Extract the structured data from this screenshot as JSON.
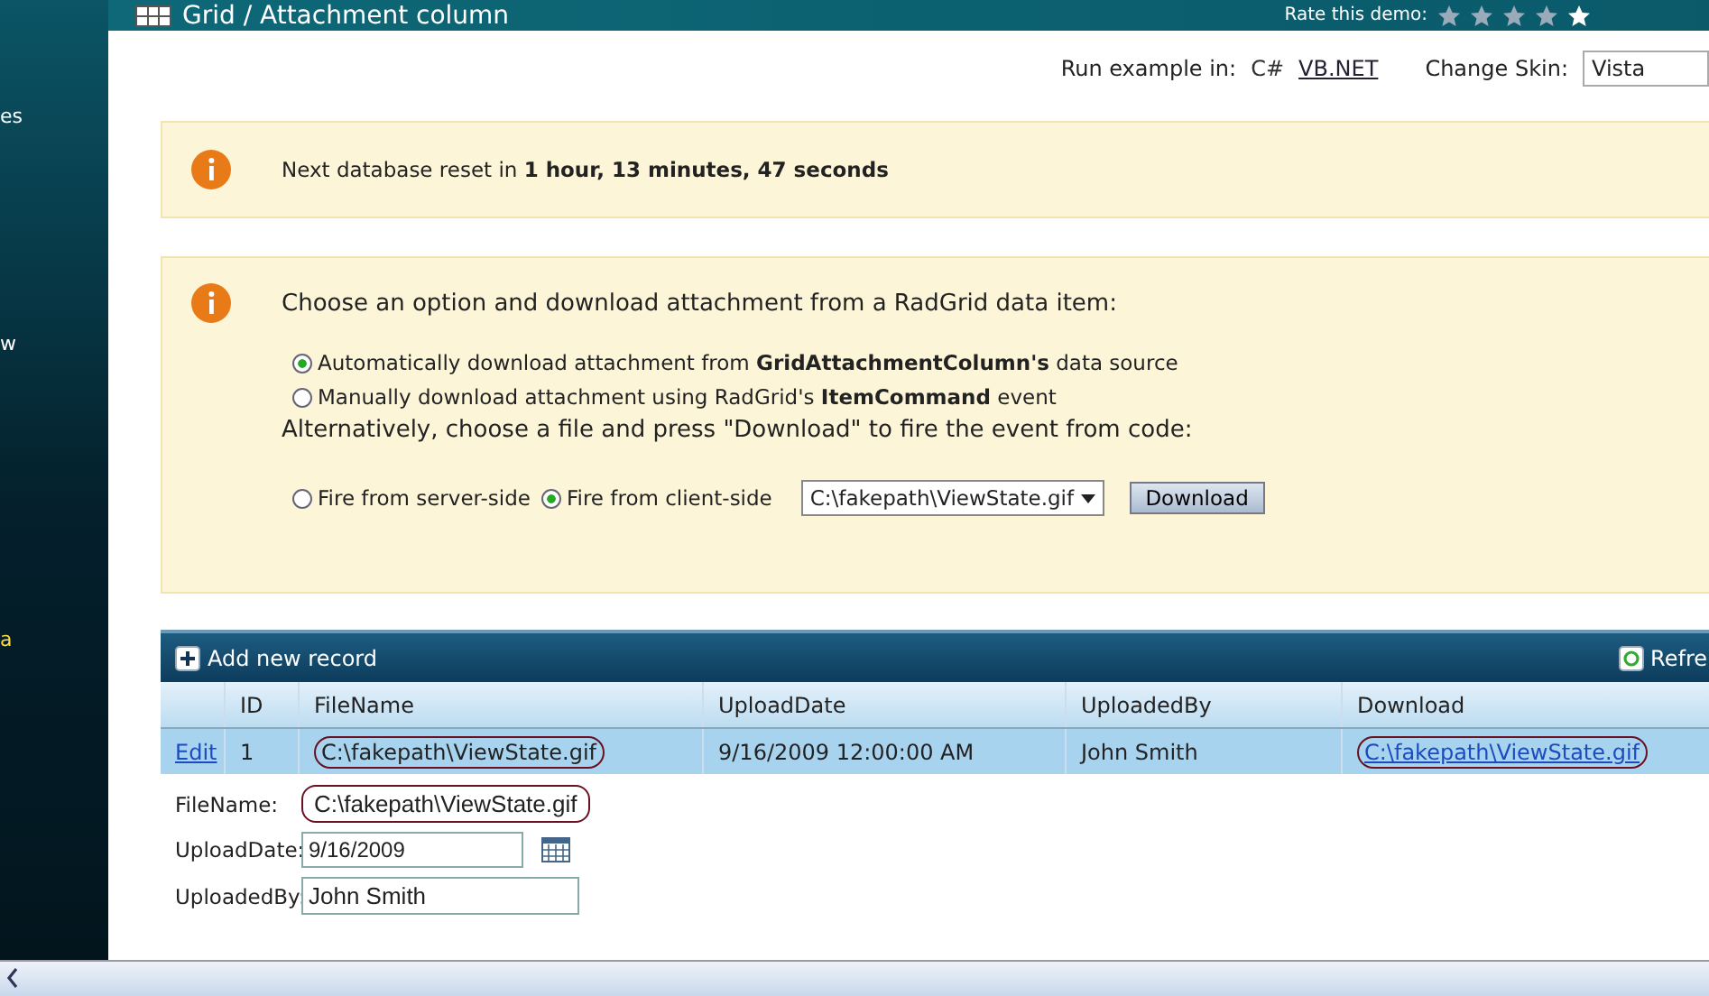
{
  "sidebar": {
    "items": [
      {
        "label": "es",
        "kind": "normal"
      },
      {
        "label": "w",
        "kind": "normal"
      },
      {
        "label": "a",
        "kind": "highlight"
      }
    ]
  },
  "header": {
    "title": "Grid / Attachment column",
    "rating_label": "Rate this demo:"
  },
  "language_bar": {
    "label": "Run example in:",
    "languages": [
      {
        "label": "C#",
        "selected": true
      },
      {
        "label": "VB.NET",
        "selected": false
      }
    ],
    "skin_label": "Change Skin:",
    "skin_value": "Vista"
  },
  "reset_notice": {
    "prefix": "Next database reset in ",
    "time": "1 hour, 13 minutes, 47 seconds"
  },
  "options_panel": {
    "heading": "Choose an option and download attachment from a RadGrid data item:",
    "modes": [
      {
        "label": "Automatically download attachment from **GridAttachmentColumn's** data source",
        "selected": true
      },
      {
        "label": "Manually download attachment using RadGrid's **ItemCommand** event",
        "selected": false
      }
    ],
    "alternative": "Alternatively, choose a file and press \"Download\" to fire the event from code:",
    "fire_options": [
      {
        "label": "Fire from server-side",
        "selected": false
      },
      {
        "label": "Fire from client-side",
        "selected": true
      }
    ],
    "file_select": "C:\\fakepath\\ViewState.gif",
    "download_button": "Download"
  },
  "grid": {
    "add_label": "Add new record",
    "refresh_label": "Refre",
    "columns": [
      "ID",
      "FileName",
      "UploadDate",
      "UploadedBy",
      "Download"
    ],
    "rows": [
      {
        "edit": "Edit",
        "id": "1",
        "file_name": "C:\\fakepath\\ViewState.gif",
        "upload_date": "9/16/2009 12:00:00 AM",
        "uploaded_by": "John Smith",
        "download": "C:\\fakepath\\ViewState.gif",
        "selected": true
      }
    ],
    "edit_form": [
      {
        "label": "FileName:",
        "value": "C:\\fakepath\\ViewState.gif",
        "kind": "highlight"
      },
      {
        "label": "UploadDate:",
        "value": "9/16/2009",
        "kind": "date"
      },
      {
        "label": "UploadedBy:",
        "value": "John Smith",
        "kind": "text"
      }
    ]
  }
}
